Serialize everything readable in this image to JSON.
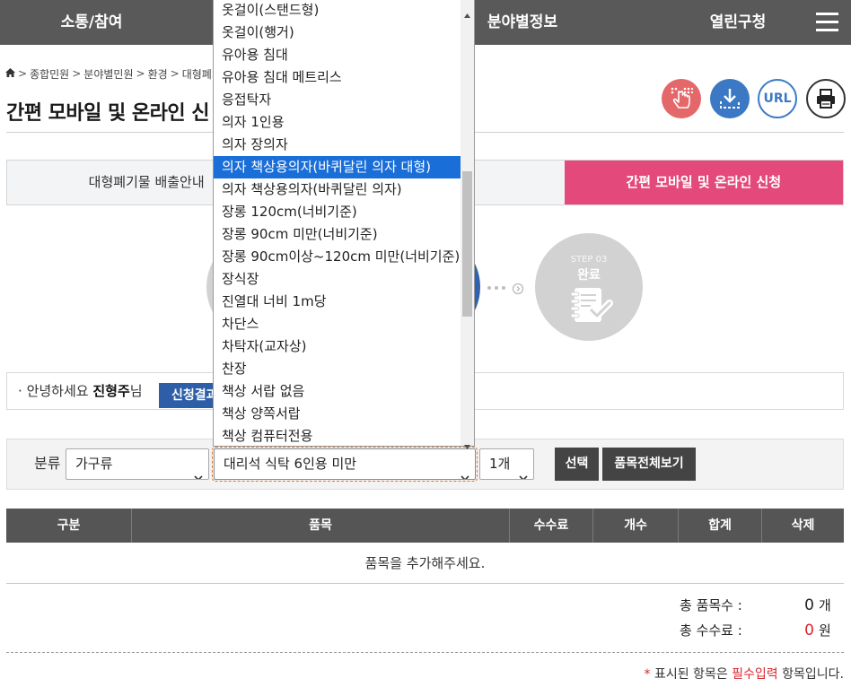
{
  "nav": {
    "items": [
      "소통/참여",
      "분야별정보",
      "열린구청"
    ],
    "menu_icon": "hamburger-menu-icon"
  },
  "breadcrumb": {
    "home_icon": "home-icon",
    "separator": ">",
    "items": [
      "종합민원",
      "분야별민원",
      "환경",
      "대형폐기"
    ]
  },
  "page_title": "간편 모바일 및 온라인 신",
  "tools": {
    "touch_icon": "touch-hand-icon",
    "download_icon": "download-icon",
    "url_label": "URL",
    "print_icon": "print-icon"
  },
  "tabs": [
    {
      "label": "대형폐기물 배출안내",
      "active": false
    },
    {
      "label": "간편 모바일 및 온라인 신청",
      "active": true
    }
  ],
  "steps": [
    {
      "status": "inactive"
    },
    {
      "status": "current"
    },
    {
      "number": "STEP 03",
      "label": "완료",
      "status": "inactive",
      "icon": "notebook-check-icon"
    }
  ],
  "greeting": {
    "bullet": "·",
    "prefix": "안녕하세요",
    "name": "진형주",
    "suffix": "님",
    "result_button": "신청결과"
  },
  "form": {
    "category_label": "분류",
    "category_value": "가구류",
    "item_value": "대리석 식탁 6인용 미만",
    "quantity_value": "1개",
    "select_button": "선택",
    "view_all_button": "품목전체보기"
  },
  "dropdown": {
    "open": true,
    "highlighted_index": 7,
    "options": [
      "옷걸이(스탠드형)",
      "옷걸이(행거)",
      "유아용 침대",
      "유아용 침대 메트리스",
      "응접탁자",
      "의자 1인용",
      "의자 장의자",
      "의자 책상용의자(바퀴달린 의자 대형)",
      "의자 책상용의자(바퀴달린 의자)",
      "장롱 120cm(너비기준)",
      "장롱 90cm 미만(너비기준)",
      "장롱 90cm이상~120cm 미만(너비기준)",
      "장식장",
      "진열대 너비 1m당",
      "차단스",
      "차탁자(교자상)",
      "찬장",
      "책상 서랍 없음",
      "책상 양쪽서랍",
      "책상 컴퓨터전용"
    ]
  },
  "table": {
    "headers": [
      "구분",
      "품목",
      "수수료",
      "개수",
      "합계",
      "삭제"
    ],
    "empty_message": "품목을 추가해주세요."
  },
  "summary": {
    "count_label": "총 품목수 :",
    "count_value": "0",
    "count_unit": "개",
    "fee_label": "총 수수료 :",
    "fee_value": "0",
    "fee_unit": "원"
  },
  "footnote": {
    "asterisk": "*",
    "text_before": "표시된 항목은",
    "required": "필수입력",
    "text_after": "항목입니다."
  },
  "colors": {
    "nav_bg": "#595959",
    "accent_pink": "#e4497b",
    "primary_blue": "#2d5ea7",
    "step_current": "#3162ad",
    "step_inactive": "#d2d2d2",
    "table_header_bg": "#555555",
    "dark_button": "#444444",
    "required_red": "#d9262c",
    "option_highlight": "#1a6ed8"
  }
}
